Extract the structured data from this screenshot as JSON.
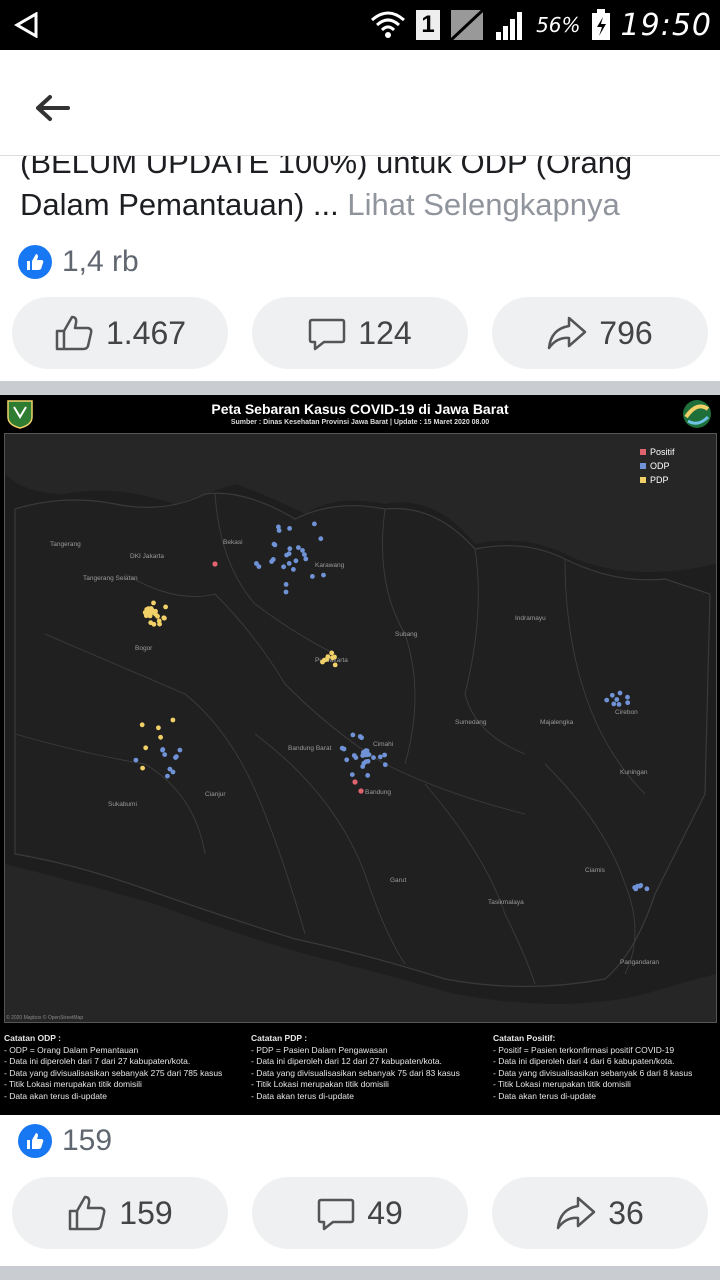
{
  "status_bar": {
    "battery": "56%",
    "sim": "1",
    "time": "19:50"
  },
  "post": {
    "text_line1": "(BELUM UPDATE 100%) untuk ODP (Orang",
    "text_line2": "Dalam Pemantauan) ... ",
    "see_more": "Lihat Selengkapnya",
    "reaction_count": "1,4 rb",
    "like_count": "1.467",
    "comment_count": "124",
    "share_count": "796"
  },
  "map": {
    "title": "Peta Sebaran Kasus COVID-19 di Jawa Barat",
    "subtitle": "Sumber : Dinas Kesehatan Provinsi Jawa Barat   |  Update : 15 Maret 2020 08.00",
    "legend": [
      {
        "label": "Positif",
        "color": "#e0646e"
      },
      {
        "label": "ODP",
        "color": "#6f93d6"
      },
      {
        "label": "PDP",
        "color": "#f2d068"
      }
    ],
    "places": [
      "Tangerang",
      "DKI Jakarta",
      "Tangerang Selatan",
      "Bekasi",
      "Bogor",
      "Karawang",
      "Purwakarta",
      "Subang",
      "Indramayu",
      "Sumedang",
      "Majalengka",
      "Cirebon",
      "Kuningan",
      "Bandung Barat",
      "Cimahi",
      "Bandung",
      "Sukabumi",
      "Cianjur",
      "Garut",
      "Tasikmalaya",
      "Ciamis",
      "Pangandaran"
    ],
    "copyright": "© 2020 Mapbox © OpenStreetMap",
    "notes": [
      {
        "heading": "Catatan ODP :",
        "lines": [
          "- ODP = Orang Dalam Pemantauan",
          "- Data ini diperoleh dari 7 dari 27 kabupaten/kota.",
          "- Data yang divisualisasikan sebanyak 275 dari 785 kasus",
          "- Titik Lokasi merupakan titik domisili",
          "- Data akan terus di-update"
        ]
      },
      {
        "heading": "Catatan PDP :",
        "lines": [
          "- PDP = Pasien Dalam Pengawasan",
          "- Data ini diperoleh dari 12 dari 27 kabupaten/kota.",
          "- Data yang divisualisasikan sebanyak 75 dari 83 kasus",
          "- Titik Lokasi merupakan titik domisili",
          "- Data akan terus di-update"
        ]
      },
      {
        "heading": "Catatan Positif:",
        "lines": [
          "- Positif = Pasien terkonfirmasi positif COVID-19",
          "- Data ini diperoleh dari 4 dari 6 kabupaten/kota.",
          "- Data yang divisualisasikan sebanyak 6 dari 8 kasus",
          "- Titik Lokasi merupakan titik domisili",
          "- Data akan terus di-update"
        ]
      }
    ]
  },
  "post2": {
    "reaction_count": "159",
    "like_count": "159",
    "comment_count": "49",
    "share_count": "36"
  }
}
